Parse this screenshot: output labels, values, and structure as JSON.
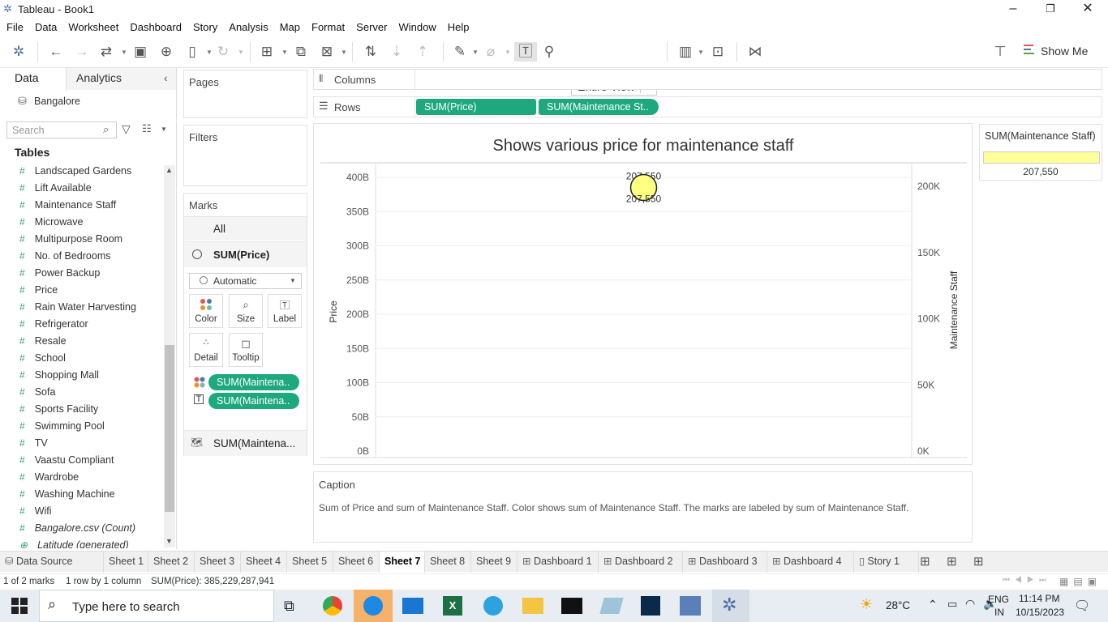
{
  "window": {
    "title": "Tableau - Book1"
  },
  "menu": [
    "File",
    "Data",
    "Worksheet",
    "Dashboard",
    "Story",
    "Analysis",
    "Map",
    "Format",
    "Server",
    "Window",
    "Help"
  ],
  "toolbar": {
    "view_select": "Entire View",
    "show_me": "Show Me"
  },
  "left_panel": {
    "tab_data": "Data",
    "tab_analytics": "Analytics",
    "datasource": "Bangalore",
    "search_placeholder": "Search",
    "tables_heading": "Tables",
    "fields": [
      "Landscaped Gardens",
      "Lift Available",
      "Maintenance Staff",
      "Microwave",
      "Multipurpose Room",
      "No. of Bedrooms",
      "Power Backup",
      "Price",
      "Rain Water Harvesting",
      "Refrigerator",
      "Resale",
      "School",
      "Shopping Mall",
      "Sofa",
      "Sports Facility",
      "Swimming Pool",
      "TV",
      "Vaastu Compliant",
      "Wardrobe",
      "Washing Machine",
      "Wifi"
    ],
    "count_field": "Bangalore.csv (Count)",
    "lat_field": "Latitude (generated)"
  },
  "cards": {
    "pages": "Pages",
    "filters": "Filters",
    "marks": "Marks",
    "all": "All",
    "sum_price": "SUM(Price)",
    "mark_type": "Automatic",
    "color": "Color",
    "size": "Size",
    "label": "Label",
    "detail": "Detail",
    "tooltip": "Tooltip",
    "pill_color": "SUM(Maintena..",
    "pill_label": "SUM(Maintena..",
    "sum_maint": "SUM(Maintena..."
  },
  "shelves": {
    "columns": "Columns",
    "rows": "Rows",
    "row_pill1": "SUM(Price)",
    "row_pill2": "SUM(Maintenance St.."
  },
  "legend": {
    "title": "SUM(Maintenance Staff)",
    "value": "207,550",
    "color": "#ffff99"
  },
  "chart_data": {
    "type": "scatter",
    "title": "Shows various price for maintenance staff",
    "ylabel": "Price",
    "y2label": "Maintenance Staff",
    "y_ticks": [
      "0B",
      "50B",
      "100B",
      "150B",
      "200B",
      "250B",
      "300B",
      "350B",
      "400B"
    ],
    "y2_ticks": [
      "0K",
      "50K",
      "100K",
      "150K",
      "200K"
    ],
    "ylim": [
      0,
      400
    ],
    "y2lim": [
      0,
      200
    ],
    "points": [
      {
        "price_b": 385.2,
        "maint_k": 207.55,
        "label_top": "207,550",
        "label_bottom": "207,550"
      }
    ],
    "mark_color": "#ffff80"
  },
  "caption": {
    "title": "Caption",
    "text": "Sum of Price and sum of Maintenance Staff.  Color shows sum of Maintenance Staff.  The marks are labeled by sum of Maintenance Staff."
  },
  "tabs": [
    "Data Source",
    "Sheet 1",
    "Sheet 2",
    "Sheet 3",
    "Sheet 4",
    "Sheet 5",
    "Sheet 6",
    "Sheet 7",
    "Sheet 8",
    "Sheet 9",
    "Dashboard 1",
    "Dashboard 2",
    "Dashboard 3",
    "Dashboard 4",
    "Story 1"
  ],
  "status": {
    "marks": "1 of 2 marks",
    "rows": "1 row by 1 column",
    "sum": "SUM(Price): 385,229,287,941"
  },
  "taskbar": {
    "search": "Type here to search",
    "weather": "28°C",
    "lang1": "ENG",
    "lang2": "IN",
    "time": "11:14 PM",
    "date": "10/15/2023"
  }
}
